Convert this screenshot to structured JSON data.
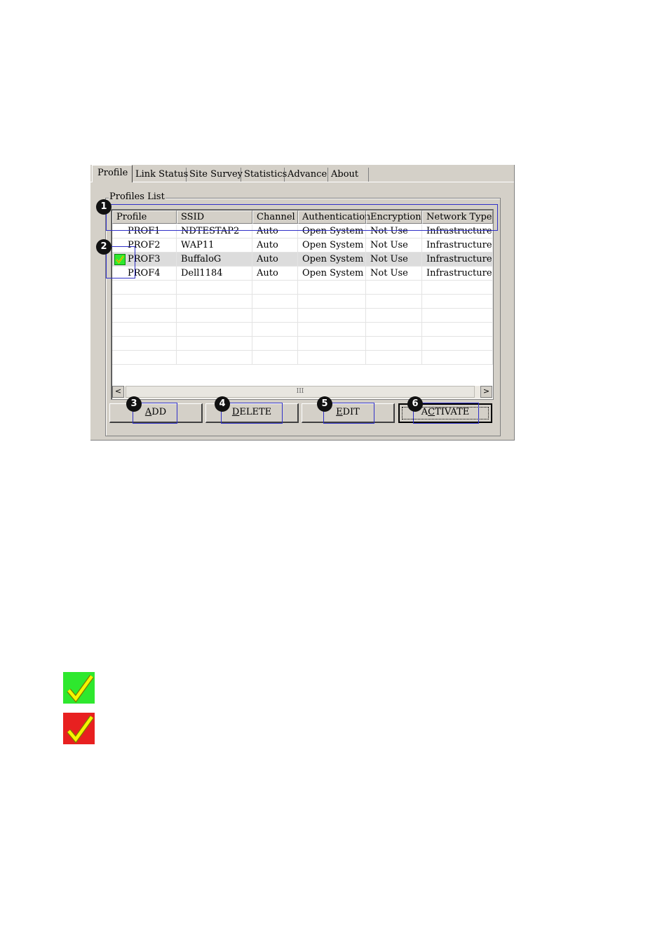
{
  "tabs": [
    "Profile",
    "Link Status",
    "Site Survey",
    "Statistics",
    "Advance",
    "About"
  ],
  "group_label": "Profiles List",
  "columns": [
    "Profile",
    "SSID",
    "Channel",
    "Authentication",
    "Encryption",
    "Network Type"
  ],
  "rows": [
    {
      "profile": "PROF1",
      "ssid": "NDTESTAP2",
      "channel": "Auto",
      "auth": "Open System",
      "enc": "Not Use",
      "type": "Infrastructure"
    },
    {
      "profile": "PROF2",
      "ssid": "WAP11",
      "channel": "Auto",
      "auth": "Open System",
      "enc": "Not Use",
      "type": "Infrastructure"
    },
    {
      "profile": "PROF3",
      "ssid": "BuffaloG",
      "channel": "Auto",
      "auth": "Open System",
      "enc": "Not Use",
      "type": "Infrastructure"
    },
    {
      "profile": "PROF4",
      "ssid": "Dell1184",
      "channel": "Auto",
      "auth": "Open System",
      "enc": "Not Use",
      "type": "Infrastructure"
    }
  ],
  "buttons": {
    "add": {
      "mnemonic": "A",
      "rest": "DD"
    },
    "delete": {
      "mnemonic": "D",
      "rest": "ELETE"
    },
    "edit": {
      "mnemonic": "E",
      "rest": "DIT"
    },
    "activate": {
      "pre": "A",
      "mnemonic": "C",
      "rest": "TIVATE"
    }
  },
  "callouts": [
    "1",
    "2",
    "3",
    "4",
    "5",
    "6"
  ],
  "scrollbar": {
    "left_arrow": "<",
    "right_arrow": ">",
    "thumb_grip": "III"
  },
  "colors": {
    "check_active": "#2ee82e",
    "check_inactive": "#e82020",
    "callout_box": "#3030c8"
  },
  "icons": {
    "row_active": "check-icon",
    "legend": [
      "check-green-icon",
      "check-red-icon"
    ]
  }
}
